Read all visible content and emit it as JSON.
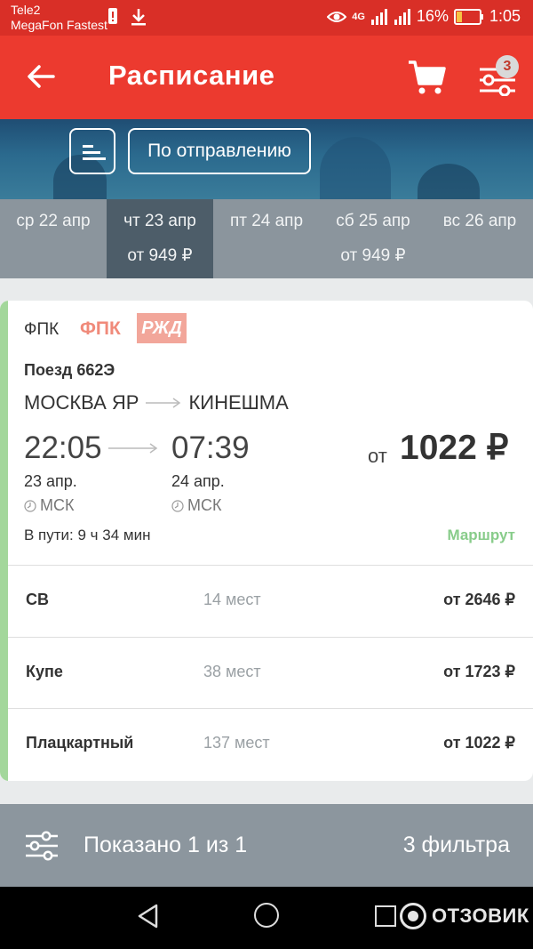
{
  "status_bar": {
    "carrier1": "Tele2",
    "carrier2": "MegaFon Fastest",
    "network": "4G",
    "battery": "16%",
    "time": "1:05"
  },
  "app_bar": {
    "title": "Расписание",
    "filter_badge": "3"
  },
  "controls": {
    "sort_label": "По отправлению"
  },
  "dates": [
    {
      "day": "ср 22 апр",
      "price": ""
    },
    {
      "day": "чт 23 апр",
      "price": "от 949 ₽",
      "active": true
    },
    {
      "day": "пт 24 апр",
      "price": ""
    },
    {
      "day": "сб 25 апр",
      "price": "от 949 ₽"
    },
    {
      "day": "вс 26 апр",
      "price": ""
    }
  ],
  "train_card": {
    "carrier_text": "ФПК",
    "carrier_logo": "ФПК",
    "rzd_logo": "РЖД",
    "train_number": "Поезд 662Э",
    "from": "МОСКВА ЯР",
    "to": "КИНЕШМА",
    "departure_time": "22:05",
    "arrival_time": "07:39",
    "departure_date": "23 апр.",
    "arrival_date": "24 апр.",
    "tz_dep": "МСК",
    "tz_arr": "МСК",
    "price_prefix": "от",
    "price": "1022 ₽",
    "duration": "В пути: 9 ч 34 мин",
    "route_link": "Маршрут",
    "classes": [
      {
        "name": "СВ",
        "seats": "14 мест",
        "price": "от 2646 ₽"
      },
      {
        "name": "Купе",
        "seats": "38 мест",
        "price": "от 1723 ₽"
      },
      {
        "name": "Плацкартный",
        "seats": "137 мест",
        "price": "от 1022 ₽"
      }
    ]
  },
  "filter_bar": {
    "shown": "Показано 1 из 1",
    "filters": "3 фильтра"
  },
  "watermark": "ОТЗОВИК",
  "colors": {
    "primary": "#ec3a2f",
    "accent_green": "#a3d79b",
    "date_bg": "#8b959d",
    "date_active": "#4d5d69"
  }
}
